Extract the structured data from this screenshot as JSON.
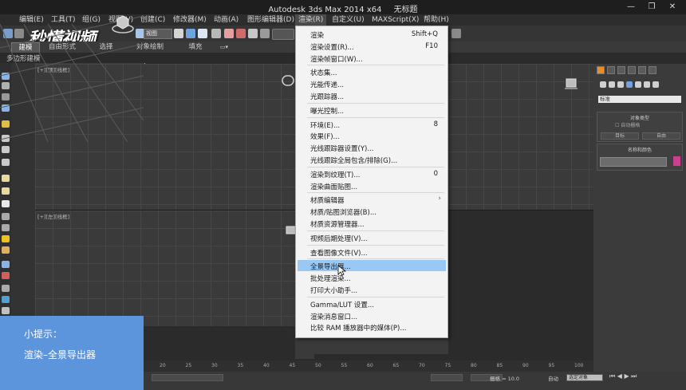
{
  "window": {
    "app_title": "Autodesk 3ds Max  2014 x64",
    "doc_title": "无标题",
    "controls": [
      "—",
      "❐",
      "✕"
    ]
  },
  "menubar": {
    "items": [
      "编辑(E)",
      "工具(T)",
      "组(G)",
      "视图(V)",
      "创建(C)",
      "修改器(M)",
      "动画(A)",
      "图形编辑器(D)",
      "渲染(R)",
      "自定义(U)",
      "MAXScript(X)",
      "帮助(H)"
    ],
    "active_index": 8
  },
  "toolbar": {
    "logo_text": "秒懂视频",
    "selection_filter": "视图"
  },
  "ribbon": {
    "tabs": [
      "建模",
      "自由形式",
      "选择",
      "对象绘制",
      "填充"
    ],
    "active_tab": 0,
    "sub_label": "多边形建模"
  },
  "viewports": {
    "top_left_label": "[+][顶][线框]",
    "bottom_left_label": "[+][左][线框]"
  },
  "render_menu": {
    "items": [
      {
        "label": "渲染",
        "shortcut": "Shift+Q"
      },
      {
        "label": "渲染设置(R)...",
        "shortcut": "F10"
      },
      {
        "label": "渲染帧窗口(W)...",
        "shortcut": ""
      },
      {
        "separator": true
      },
      {
        "label": "状态集...",
        "shortcut": ""
      },
      {
        "label": "光能传递...",
        "shortcut": ""
      },
      {
        "label": "光跟踪器...",
        "shortcut": ""
      },
      {
        "separator": true
      },
      {
        "label": "曝光控制...",
        "shortcut": ""
      },
      {
        "separator": true
      },
      {
        "label": "环境(E)...",
        "shortcut": "8"
      },
      {
        "label": "效果(F)...",
        "shortcut": ""
      },
      {
        "label": "光线跟踪器设置(Y)...",
        "shortcut": ""
      },
      {
        "label": "光线跟踪全局包含/排除(G)...",
        "shortcut": ""
      },
      {
        "separator": true
      },
      {
        "label": "渲染到纹理(T)...",
        "shortcut": "0"
      },
      {
        "label": "渲染曲面贴图...",
        "shortcut": ""
      },
      {
        "separator": true
      },
      {
        "label": "材质编辑器",
        "shortcut": "",
        "submenu": true
      },
      {
        "label": "材质/贴图浏览器(B)...",
        "shortcut": ""
      },
      {
        "label": "材质资源管理器...",
        "shortcut": ""
      },
      {
        "separator": true
      },
      {
        "label": "视频后期处理(V)...",
        "shortcut": ""
      },
      {
        "separator": true
      },
      {
        "label": "查看图像文件(V)...",
        "shortcut": ""
      },
      {
        "separator": true
      },
      {
        "label": "全景导出器...",
        "shortcut": "",
        "highlighted": true
      },
      {
        "label": "批处理渲染...",
        "shortcut": ""
      },
      {
        "label": "打印大小助手...",
        "shortcut": ""
      },
      {
        "separator": true
      },
      {
        "label": "Gamma/LUT 设置...",
        "shortcut": ""
      },
      {
        "label": "渲染消息窗口...",
        "shortcut": ""
      },
      {
        "label": "比较 RAM 播放器中的媒体(P)...",
        "shortcut": ""
      }
    ]
  },
  "command_panel": {
    "dropdown_value": "标准",
    "object_type_title": "对象类型",
    "auto_grid": "自动栅格",
    "btn_a": "目标",
    "btn_b": "自由",
    "name_color_title": "名称和颜色",
    "swatch_color": "#cc3e8e"
  },
  "timeline": {
    "ticks": [
      "20",
      "25",
      "30",
      "35",
      "40",
      "45",
      "50",
      "55",
      "60",
      "65",
      "70",
      "75",
      "80",
      "85",
      "90",
      "95",
      "100"
    ]
  },
  "statusbar": {
    "grid_label": "栅格 = 10.0",
    "auto_key": "自动",
    "set_key_dropdown": "选定对象"
  },
  "tip": {
    "title": "小提示：",
    "body": "渲染–全景导出器"
  },
  "colors": {
    "menu_highlight": "#99c8f5",
    "tip_bg": "#5d95dd",
    "active_tab": "#ea8b2a"
  }
}
